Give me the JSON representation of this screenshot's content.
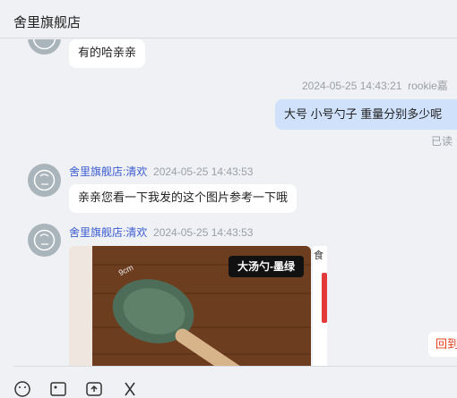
{
  "header": {
    "title": "舍里旗舰店"
  },
  "messages": {
    "m1": {
      "text": "有的哈亲亲"
    },
    "m2": {
      "time": "2024-05-25 14:43:21",
      "sender": "rookie嘉",
      "text": "大号 小号勺子 重量分别多少呢",
      "status": "已读"
    },
    "m3": {
      "sender": "舍里旗舰店:清欢",
      "time": "2024-05-25 14:43:53",
      "text": "亲亲您看一下我发的这个图片参考一下哦"
    },
    "m4": {
      "sender": "舍里旗舰店:清欢",
      "time": "2024-05-25 14:43:53",
      "image_tag": "大汤勺-墨绿",
      "image_dim": "9cm",
      "side_char": "食"
    }
  },
  "return_button": {
    "label": "回到"
  },
  "toolbar": {
    "icons": [
      "emoji-icon",
      "image-icon",
      "upload-icon",
      "scissors-icon"
    ]
  },
  "colors": {
    "sender": "#3a5bd1",
    "my_bubble": "#cfe1fb",
    "accent_red": "#e0401e"
  }
}
